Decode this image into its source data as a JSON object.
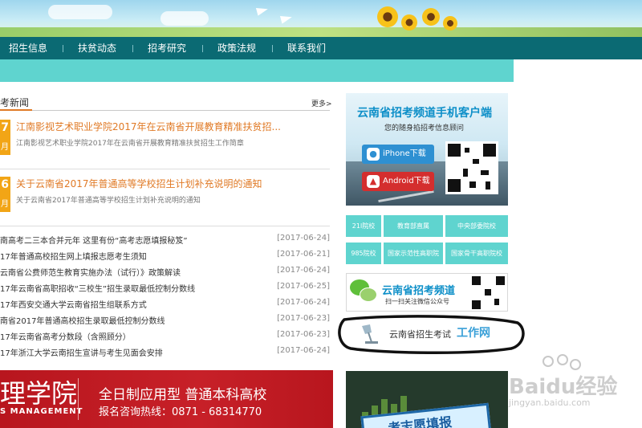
{
  "nav": {
    "items": [
      "招生信息",
      "扶贫动态",
      "招考研究",
      "政策法规",
      "联系我们"
    ]
  },
  "news": {
    "section_title": "考新闻",
    "more": "更多>",
    "features": [
      {
        "day": "7",
        "month": "月",
        "title": "江南影视艺术职业学院2017年在云南省开展教育精准扶贫招...",
        "desc": "江南影视艺术职业学院2017年在云南省开展教育精准扶贫招生工作简章"
      },
      {
        "day": "6",
        "month": "月",
        "title": "关于云南省2017年普通高等学校招生计划补充说明的通知",
        "desc": "关于云南省2017年普通高等学校招生计划补充说明的通知"
      }
    ],
    "list": [
      {
        "title": "南高考二三本合并元年 这里有份“高考志愿填报秘笈”",
        "date": "[2017-06-24]"
      },
      {
        "title": "17年普通高校招生网上填报志愿考生须知",
        "date": "[2017-06-21]"
      },
      {
        "title": "云南省公费师范生教育实施办法（试行）》政策解读",
        "date": "[2017-06-24]"
      },
      {
        "title": "17年云南省高职招收“三校生”招生录取最低控制分数线",
        "date": "[2017-06-25]"
      },
      {
        "title": "17年西安交通大学云南省招生组联系方式",
        "date": "[2017-06-24]"
      },
      {
        "title": "南省2017年普通高校招生录取最低控制分数线",
        "date": "[2017-06-23]"
      },
      {
        "title": "17年云南省高考分数段（含照顾分）",
        "date": "[2017-06-23]"
      },
      {
        "title": "17年浙江大学云南招生宣讲与考生见面会安排",
        "date": "[2017-06-24]"
      }
    ]
  },
  "ad_banner": {
    "college_chars": "理学院",
    "english": "S MANAGEMENT",
    "slogan": "全日制应用型 普通本科高校",
    "hotline": "报名咨询热线：0871 - 68314770"
  },
  "app_card": {
    "title": "云南省招考频道手机客户端",
    "subtitle": "您的随身掐招考信息顾问",
    "iphone_label": "iPhone下载",
    "android_label": "Android下载",
    "iphone_icon": "apple-icon",
    "android_icon": "android-icon"
  },
  "links": [
    "21l院校",
    "教育部直属",
    "中央部委院校",
    "985院校",
    "国家示范性高职院",
    "国家骨干高职院校"
  ],
  "wechat": {
    "name": "云南省招考频道",
    "sub": "扫一扫关注微信公众号"
  },
  "kaoshi": {
    "label": "云南省招生考试",
    "brand": "工作网"
  },
  "edu_banner": {
    "text": "考志愿填报"
  },
  "watermark": {
    "text": "Baidu经验",
    "url": "jingyan.baidu.com"
  },
  "colors": {
    "nav": "#0b6a73",
    "teal": "#5fd4cf",
    "accent_orange": "#e07a26",
    "date_badge": "#f2a516",
    "ad_red": "#c72028",
    "link_blue": "#0d8fc8"
  }
}
